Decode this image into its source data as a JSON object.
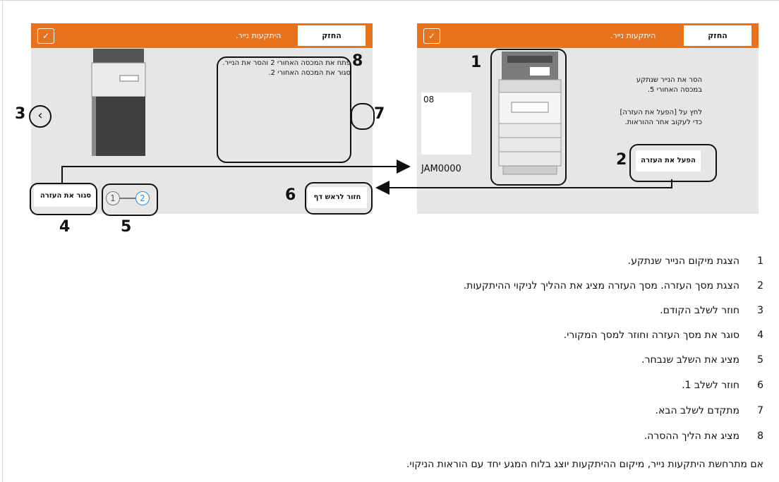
{
  "right_panel": {
    "logo": "✓",
    "tab_label": "החזק",
    "title": "היתקעות נייר.",
    "jam_count": "08",
    "jam_code": "JAM0000",
    "instruction_1": "הסר את הנייר שנתקע במכסה האחורי 5.",
    "instruction_2": "לחץ על [הפעל את העזרה] כדי לעקוב אחר ההוראות.",
    "help_button": "הפעל את העזרה"
  },
  "left_panel": {
    "logo": "✓",
    "tab_label": "החזק",
    "title": "היתקעות נייר.",
    "steps_text_1": "פתח את המכסה האחורי 2 והסר את הנייר.",
    "steps_text_2": "סגור את המכסה האחורי 2.",
    "close_help_button": "סגור את העזרה",
    "back_to_top_button": "חזור לראש דף",
    "step_1": "1",
    "step_2": "2",
    "prev_arrow": "‹"
  },
  "callout_numbers": {
    "n1": "1",
    "n2": "2",
    "n3": "3",
    "n4": "4",
    "n5": "5",
    "n6": "6",
    "n7": "7",
    "n8": "8"
  },
  "legend": [
    {
      "num": "1",
      "text": "הצגת מיקום הנייר שנתקע."
    },
    {
      "num": "2",
      "text": "הצגת מסך העזרה. מסך העזרה מציג את ההליך לניקוי ההיתקעות."
    },
    {
      "num": "3",
      "text": "חוזר לשלב הקודם."
    },
    {
      "num": "4",
      "text": "סוגר את מסך העזרה וחוזר למסך המקורי."
    },
    {
      "num": "5",
      "text": "מציג את השלב שנבחר."
    },
    {
      "num": "6",
      "text": "חוזר לשלב 1."
    },
    {
      "num": "7",
      "text": "מתקדם לשלב הבא."
    },
    {
      "num": "8",
      "text": "מציג את הליך ההסרה."
    }
  ],
  "footer": "אם מתרחשת היתקעות נייר, מיקום ההיתקעות יוצג בלוח המגע יחד עם הוראות הניקוי."
}
